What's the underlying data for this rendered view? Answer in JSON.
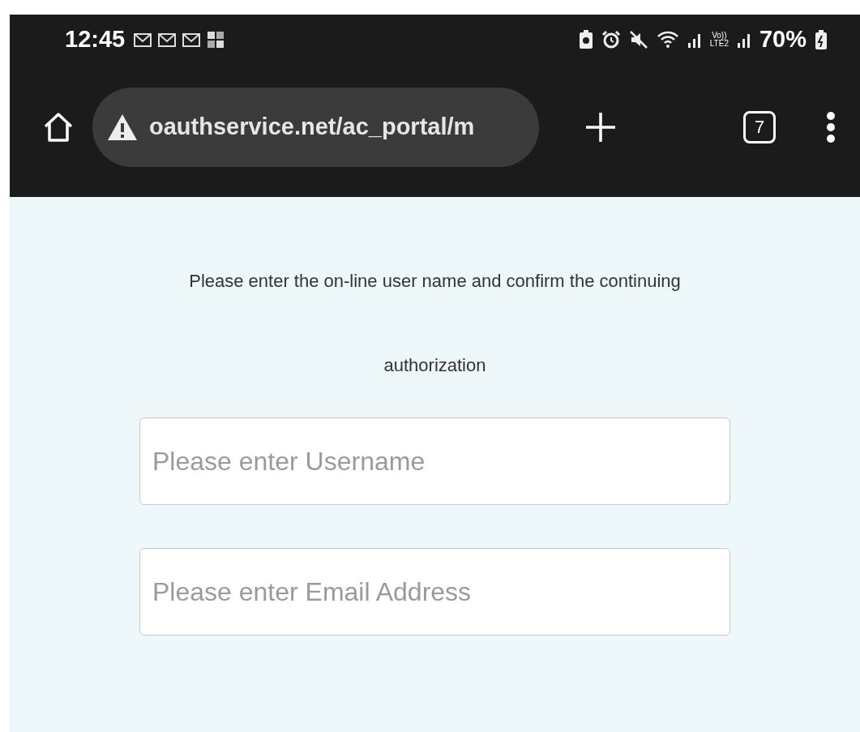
{
  "status_bar": {
    "time": "12:45",
    "volte": "Vo))",
    "network": "LTE2",
    "battery": "70%"
  },
  "browser": {
    "url": "oauthservice.net/ac_portal/m",
    "tab_count": "7"
  },
  "page": {
    "message": "Please enter the on-line user name and confirm the continuing authorization",
    "fields": [
      {
        "placeholder": "Please enter Username"
      },
      {
        "placeholder": "Please enter Email Address"
      }
    ]
  }
}
